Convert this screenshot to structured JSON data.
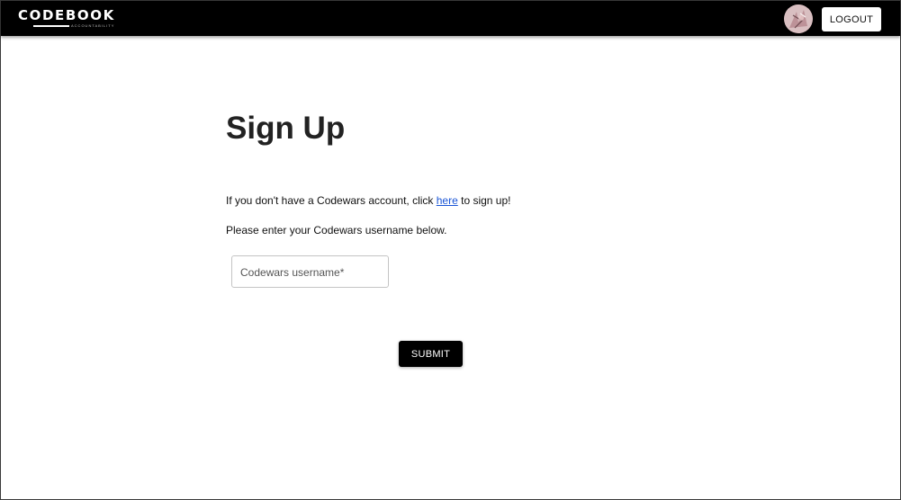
{
  "header": {
    "brand_name": "CODEBOOK",
    "brand_tagline": "ACCOUNTABILITY",
    "logout_label": "LOGOUT",
    "background_color": "#000000"
  },
  "main": {
    "title": "Sign Up",
    "intro_before_link": "If you don't have a Codewars account, click ",
    "intro_link_text": "here",
    "intro_after_link": " to sign up!",
    "instruction": "Please enter your Codewars username below.",
    "username_field": {
      "label": "Codewars username",
      "required_marker": "*",
      "value": ""
    },
    "submit_label": "SUBMIT"
  },
  "colors": {
    "link": "#1a55d6",
    "primary_button": "#000000"
  }
}
